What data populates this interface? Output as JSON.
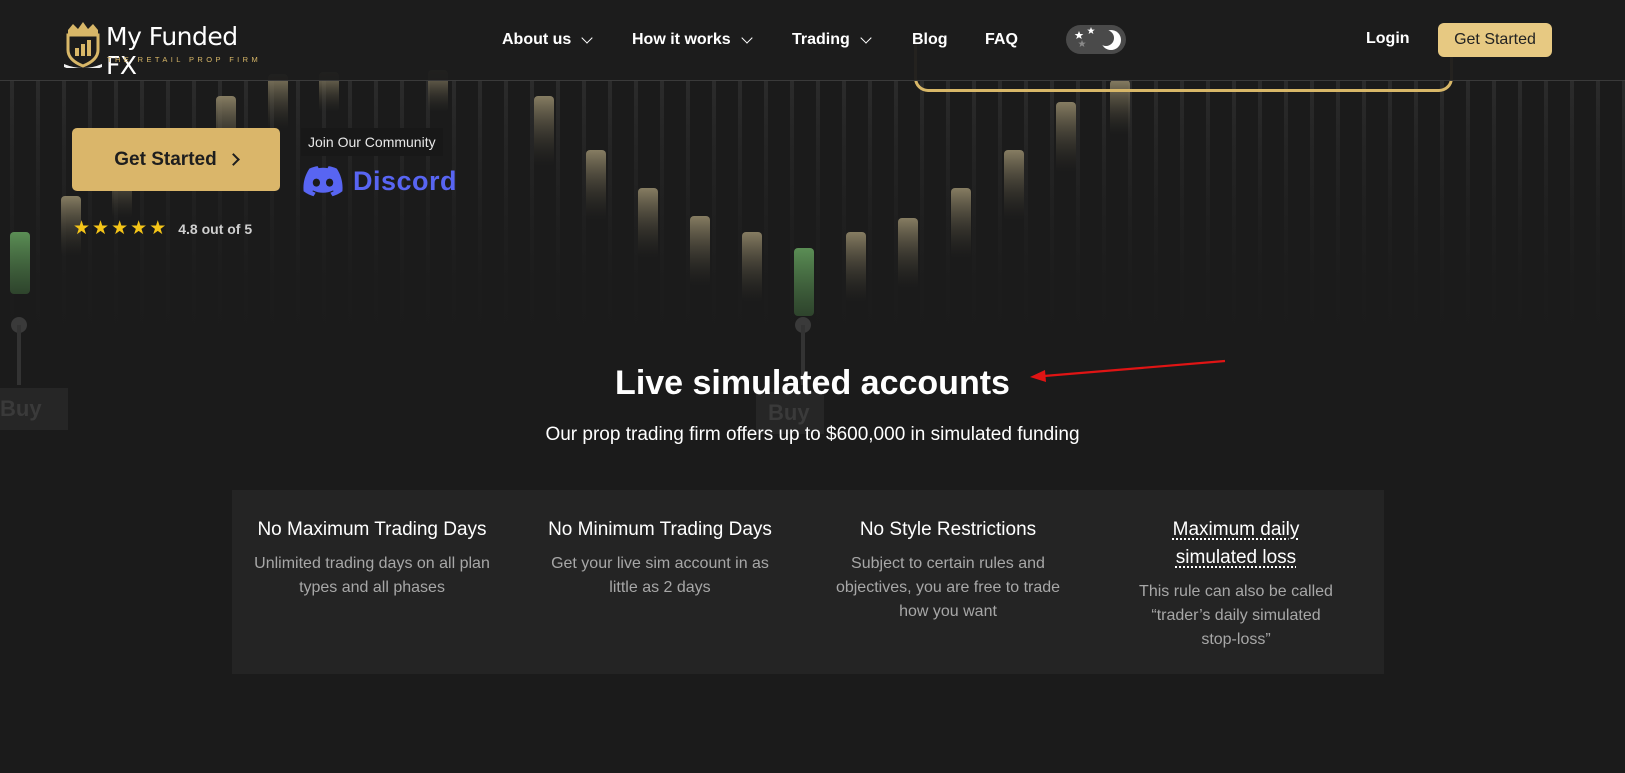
{
  "header": {
    "logo_text": "My Funded FX",
    "logo_tagline": "THE RETAIL PROP FIRM",
    "nav": [
      {
        "label": "About us",
        "dropdown": true
      },
      {
        "label": "How it works",
        "dropdown": true
      },
      {
        "label": "Trading",
        "dropdown": true
      },
      {
        "label": "Blog",
        "dropdown": false
      },
      {
        "label": "FAQ",
        "dropdown": false
      }
    ],
    "login_label": "Login",
    "cta_label": "Get Started"
  },
  "hero": {
    "cta_label": "Get Started",
    "community_label": "Join Our Community",
    "discord_label": "Discord",
    "rating_text": "4.8 out of 5",
    "stars": 5
  },
  "background_chart": {
    "buy_label": "Buy"
  },
  "section": {
    "title": "Live simulated accounts",
    "subtitle": "Our prop trading firm offers up to $600,000 in simulated funding",
    "features": [
      {
        "title": "No Maximum Trading Days",
        "description": "Unlimited trading days on all plan types and all phases"
      },
      {
        "title": "No Minimum Trading Days",
        "description": "Get your live sim account in as little as 2 days"
      },
      {
        "title": "No Style Restrictions",
        "description": "Subject to certain rules and objectives, you are free to trade how you want"
      },
      {
        "title": "Maximum daily simulated loss",
        "description": "This rule can also be called “trader’s daily simulated stop-loss”"
      }
    ]
  },
  "colors": {
    "background": "#1b1b1b",
    "gold": "#dab66a",
    "gold_light": "#e7c982",
    "discord": "#5865f2",
    "star": "#f5c518",
    "annotation": "#e01414"
  }
}
